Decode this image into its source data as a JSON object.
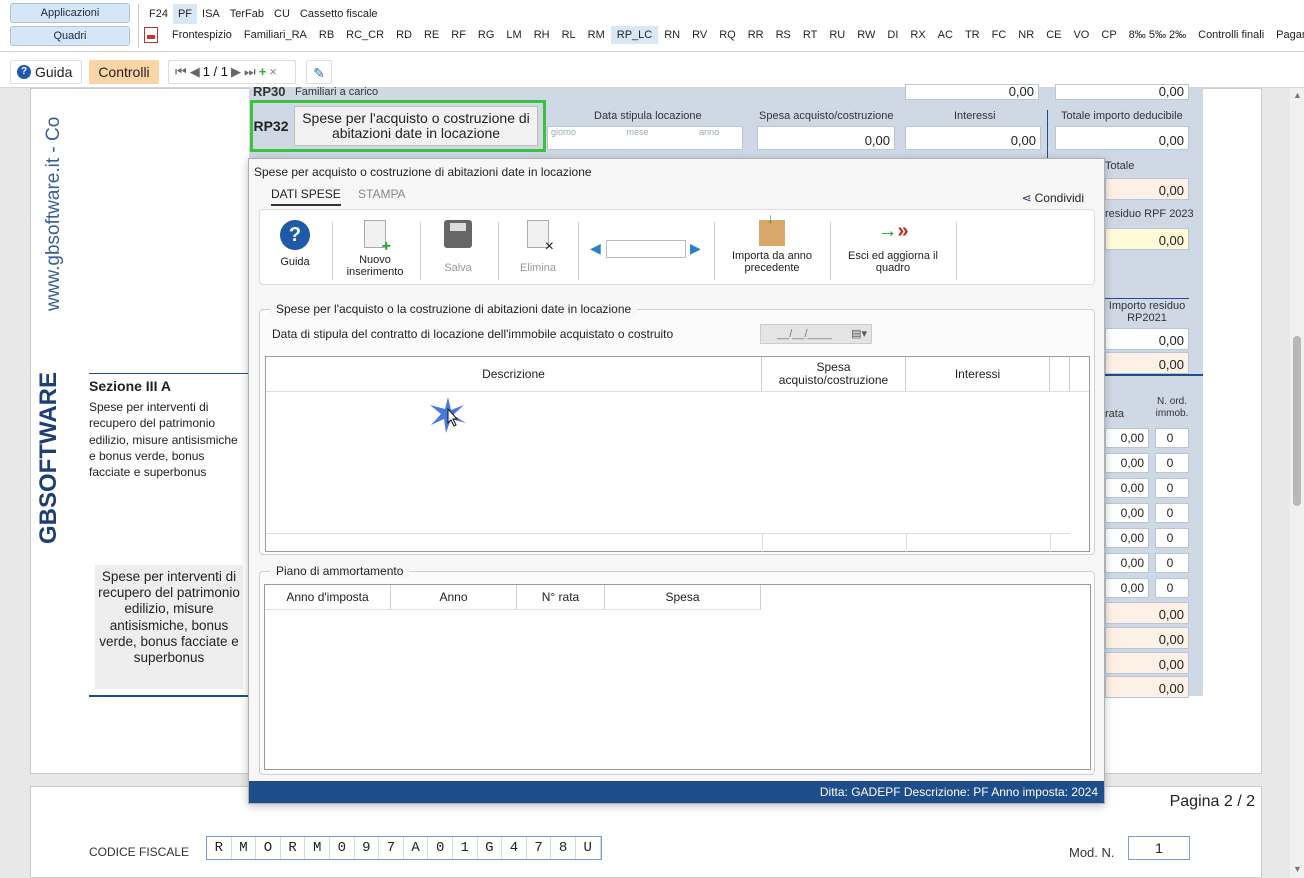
{
  "nav": {
    "applicazioni": "Applicazioni",
    "quadri": "Quadri",
    "row1": [
      "F24",
      "PF",
      "ISA",
      "TerFab",
      "CU",
      "Cassetto fiscale"
    ],
    "row2": [
      "Frontespizio",
      "Familiari_RA",
      "RB",
      "RC_CR",
      "RD",
      "RE",
      "RF",
      "RG",
      "LM",
      "RH",
      "RL",
      "RM",
      "RP_LC",
      "RN",
      "RV",
      "RQ",
      "RR",
      "RS",
      "RT",
      "RU",
      "RW",
      "DI",
      "RX",
      "AC",
      "TR",
      "FC",
      "NR",
      "CE",
      "VO",
      "CP",
      "8‰ 5‰ 2‰",
      "Controlli finali",
      "Pagame"
    ]
  },
  "toolbar": {
    "guida": "Guida",
    "controlli": "Controlli",
    "page": "1 / 1"
  },
  "form": {
    "rp30_label": "RP30",
    "rp30_text": "Familiari a carico",
    "rp32_code": "RP32",
    "rp32_button": "Spese per l'acquisto o costruzione di abitazioni date in locazione",
    "col_data": "Data stipula locazione",
    "col_spesa": "Spesa acquisto/costruzione",
    "col_interessi": "Interessi",
    "col_totale": "Totale importo deducibile",
    "giorno": "giorno",
    "mese": "mese",
    "anno": "anno",
    "zero": "0,00",
    "totale": "Totale",
    "residuo_rpf": "residuo RPF 2023",
    "importo_residuo": "Importo residuo RP2021",
    "rata": "rata",
    "nord": "N. ord. immob.",
    "sezione_title": "Sezione III A",
    "sezione_text": "Spese per interventi di recupero del patrimonio edilizio, misure antisismiche e bonus verde, bonus facciate e superbonus",
    "box_text": "Spese per interventi di recupero del patrimonio edilizio, misure antisismiche, bonus verde, bonus facciate e superbonus",
    "watermark": "www.gbsoftware.it - Co",
    "brand": "GBSOFTWARE",
    "pagina": "Pagina 2 / 2",
    "codice_fiscale_label": "CODICE FISCALE",
    "codice_fiscale": [
      "R",
      "M",
      "O",
      "R",
      "M",
      "0",
      "9",
      "7",
      "A",
      "0",
      "1",
      "G",
      "4",
      "7",
      "8",
      "U"
    ],
    "mod_n_label": "Mod. N.",
    "mod_n": "1",
    "small_zero": "0,00",
    "int_zero": "0"
  },
  "dialog": {
    "title": "Spese per acquisto o costruzione di abitazioni date in locazione",
    "tab_dati": "DATI SPESE",
    "tab_stampa": "STAMPA",
    "condividi": "Condividi",
    "btn_guida": "Guida",
    "btn_nuovo": "Nuovo inserimento",
    "btn_salva": "Salva",
    "btn_elimina": "Elimina",
    "btn_importa": "Importa da anno precedente",
    "btn_esci": "Esci ed aggiorna il quadro",
    "fs1_legend": "Spese per l'acquisto o la costruzione di abitazioni date in locazione",
    "data_stipula_label": "Data di stipula del contratto di locazione dell'immobile acquistato o costruito",
    "date_placeholder": "__/__/____",
    "grid1_headers": [
      "Descrizione",
      "Spesa acquisto/costruzione",
      "Interessi"
    ],
    "fs2_legend": "Piano di ammortamento",
    "grid2_headers": [
      "Anno d'imposta",
      "Anno",
      "N° rata",
      "Spesa"
    ],
    "status": "Ditta: GADEPF   Descrizione: PF   Anno imposta: 2024"
  },
  "colors": {
    "accent": "#1e4d8c",
    "highlight": "#3cc23c",
    "formpanel": "#cfd9e6"
  }
}
